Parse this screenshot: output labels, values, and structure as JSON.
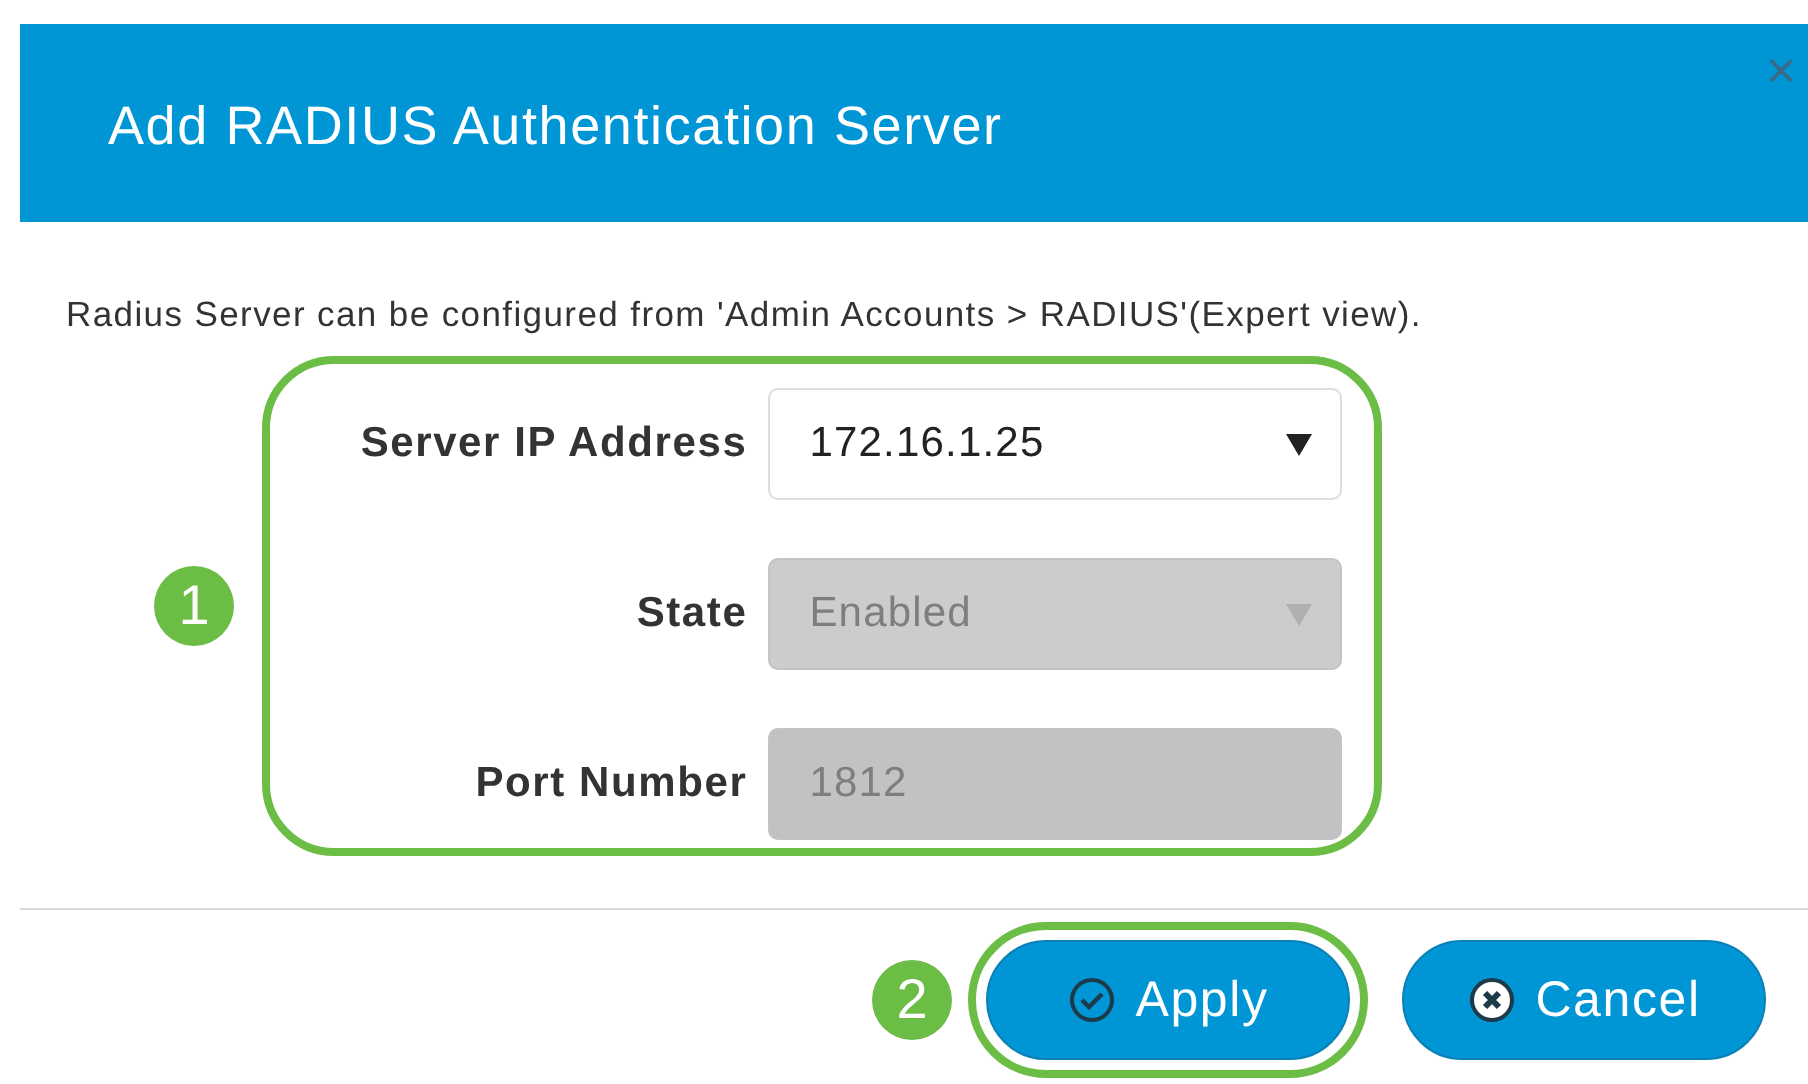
{
  "dialog": {
    "title": "Add RADIUS Authentication Server",
    "close": "×"
  },
  "note": "Radius Server can be configured from 'Admin Accounts > RADIUS'(Expert view).",
  "fields_callout": "1",
  "fields": [
    {
      "label": "Server IP Address",
      "kind": "select",
      "value": "172.16.1.25",
      "disabled": false
    },
    {
      "label": "State",
      "kind": "select",
      "value": "Enabled",
      "disabled": true
    },
    {
      "label": "Port Number",
      "kind": "input",
      "value": "1812",
      "disabled": true
    }
  ],
  "buttons": [
    {
      "label": "Apply",
      "kind": "apply",
      "callout": "2",
      "highlighted": true
    },
    {
      "label": "Cancel",
      "kind": "cancel",
      "highlighted": false
    }
  ]
}
